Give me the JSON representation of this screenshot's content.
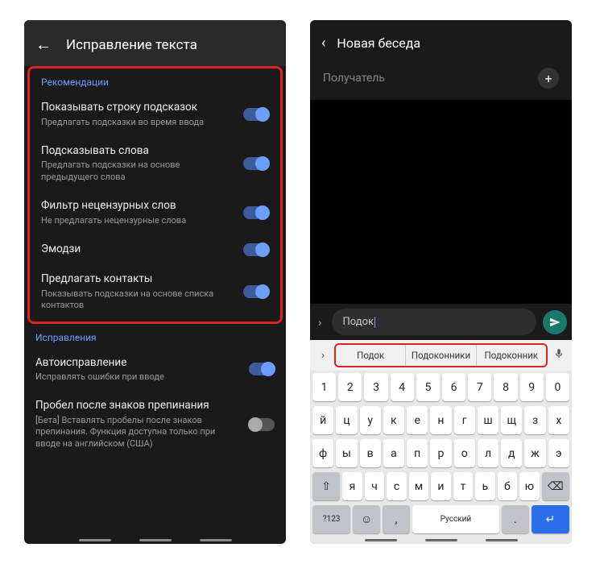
{
  "left": {
    "header_title": "Исправление текста",
    "sections": [
      {
        "title": "Рекомендации",
        "items": [
          {
            "title": "Показывать строку подсказок",
            "sub": "Предлагать подсказки во время ввода",
            "on": true
          },
          {
            "title": "Подсказывать слова",
            "sub": "Предлагать подсказки на основе предыдущего слова",
            "on": true
          },
          {
            "title": "Фильтр нецензурных слов",
            "sub": "Не предлагать нецензурные слова",
            "on": true
          },
          {
            "title": "Эмодзи",
            "sub": "",
            "on": true
          },
          {
            "title": "Предлагать контакты",
            "sub": "Показывать подсказки на основе списка контактов",
            "on": true
          }
        ]
      },
      {
        "title": "Исправления",
        "items": [
          {
            "title": "Автоисправление",
            "sub": "Исправлять ошибки при вводе",
            "on": true
          },
          {
            "title": "Пробел после знаков препинания",
            "sub": "[Бета] Вставлять пробелы после знаков препинания. Функция доступна только при вводе на английском (США)",
            "on": false
          }
        ]
      }
    ]
  },
  "right": {
    "header_title": "Новая беседа",
    "recipient_label": "Получатель",
    "input_value": "Подок",
    "suggestions": [
      "Подок",
      "Подоконники",
      "Подоконник"
    ],
    "keyboard": {
      "row_num": [
        "1",
        "2",
        "3",
        "4",
        "5",
        "6",
        "7",
        "8",
        "9",
        "0"
      ],
      "row1": [
        "й",
        "ц",
        "у",
        "к",
        "е",
        "н",
        "г",
        "ш",
        "щ",
        "з",
        "х"
      ],
      "row2": [
        "ф",
        "ы",
        "в",
        "а",
        "п",
        "р",
        "о",
        "л",
        "д",
        "ж",
        "э"
      ],
      "row3_shift": "⇧",
      "row3": [
        "я",
        "ч",
        "с",
        "м",
        "и",
        "т",
        "ь",
        "б",
        "ю"
      ],
      "row3_back": "⌫",
      "row4_sym": "?123",
      "row4_emoji": "☺",
      "row4_comma": ",",
      "row4_space": "Русский",
      "row4_dot": ".",
      "row4_enter": "↵"
    }
  }
}
